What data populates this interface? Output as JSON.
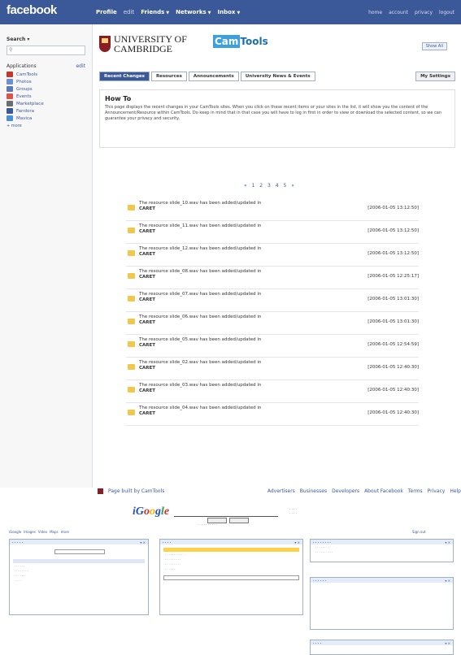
{
  "facebook": {
    "logo": "facebook",
    "nav": [
      "Profile",
      "edit",
      "Friends",
      "Networks",
      "Inbox"
    ],
    "nav_right": [
      "home",
      "account",
      "privacy",
      "logout"
    ],
    "search_label": "Search",
    "applications_label": "Applications",
    "edit_label": "edit",
    "apps": [
      {
        "label": "CamTools",
        "color": "#c0392b"
      },
      {
        "label": "Photos",
        "color": "#6b8fcf"
      },
      {
        "label": "Groups",
        "color": "#5b7bb8"
      },
      {
        "label": "Events",
        "color": "#d9534f"
      },
      {
        "label": "Marketplace",
        "color": "#6d6d6d"
      },
      {
        "label": "Fandora",
        "color": "#3b5998"
      },
      {
        "label": "Mavica",
        "color": "#4a90d9"
      }
    ],
    "more_label": "more"
  },
  "camtools": {
    "university_line1": "UNIVERSITY OF",
    "university_line2": "CAMBRIDGE",
    "cam": "Cam",
    "tools": "Tools",
    "show_button": "Show All",
    "tabs": [
      "Recent Changes",
      "Resources",
      "Announcements",
      "University News & Events"
    ],
    "settings_tab": "My Settings",
    "howto_title": "How To",
    "howto_text": "This page displays the recent changes in your CamTools sites. When you click on these recent items or your sites in the list, it will show you the content of the Announcement/Resource within CamTools. Do keep in mind that in that case you will have to log in first in order to view or download the selected content, so we can guarantee your privacy and security.",
    "pager": "« 1 2 3 4 5 »",
    "rows": [
      {
        "text": "The resource slide_10.wav has been added/updated in",
        "site": "CARET",
        "date": "[2006-01-05 13:12:50]"
      },
      {
        "text": "The resource slide_11.wav has been added/updated in",
        "site": "CARET",
        "date": "[2006-01-05 13:12:50]"
      },
      {
        "text": "The resource slide_12.wav has been added/updated in",
        "site": "CARET",
        "date": "[2006-01-05 13:12:50]"
      },
      {
        "text": "The resource slide_08.wav has been added/updated in",
        "site": "CARET",
        "date": "[2006-01-05 12:25:17]"
      },
      {
        "text": "The resource slide_07.wav has been added/updated in",
        "site": "CARET",
        "date": "[2006-01-05 13:01:30]"
      },
      {
        "text": "The resource slide_06.wav has been added/updated in",
        "site": "CARET",
        "date": "[2006-01-05 13:01:30]"
      },
      {
        "text": "The resource slide_05.wav has been added/updated in",
        "site": "CARET",
        "date": "[2006-01-05 12:54:59]"
      },
      {
        "text": "The resource slide_02.wav has been added/updated in",
        "site": "CARET",
        "date": "[2006-01-05 12:40:30]"
      },
      {
        "text": "The resource slide_03.wav has been added/updated in",
        "site": "CARET",
        "date": "[2006-01-05 12:40:30]"
      },
      {
        "text": "The resource slide_04.wav has been added/updated in",
        "site": "CARET",
        "date": "[2006-01-05 12:40:30]"
      }
    ],
    "footer_built": "Page built by CamTools",
    "footer_links": [
      "Advertisers",
      "Businesses",
      "Developers",
      "About Facebook",
      "Terms",
      "Privacy",
      "Help"
    ]
  },
  "google": {
    "logo": "iGoogle",
    "links": [
      "iGoogle",
      "Images",
      "Video",
      "Maps",
      "more"
    ],
    "signin": "Sign out"
  }
}
